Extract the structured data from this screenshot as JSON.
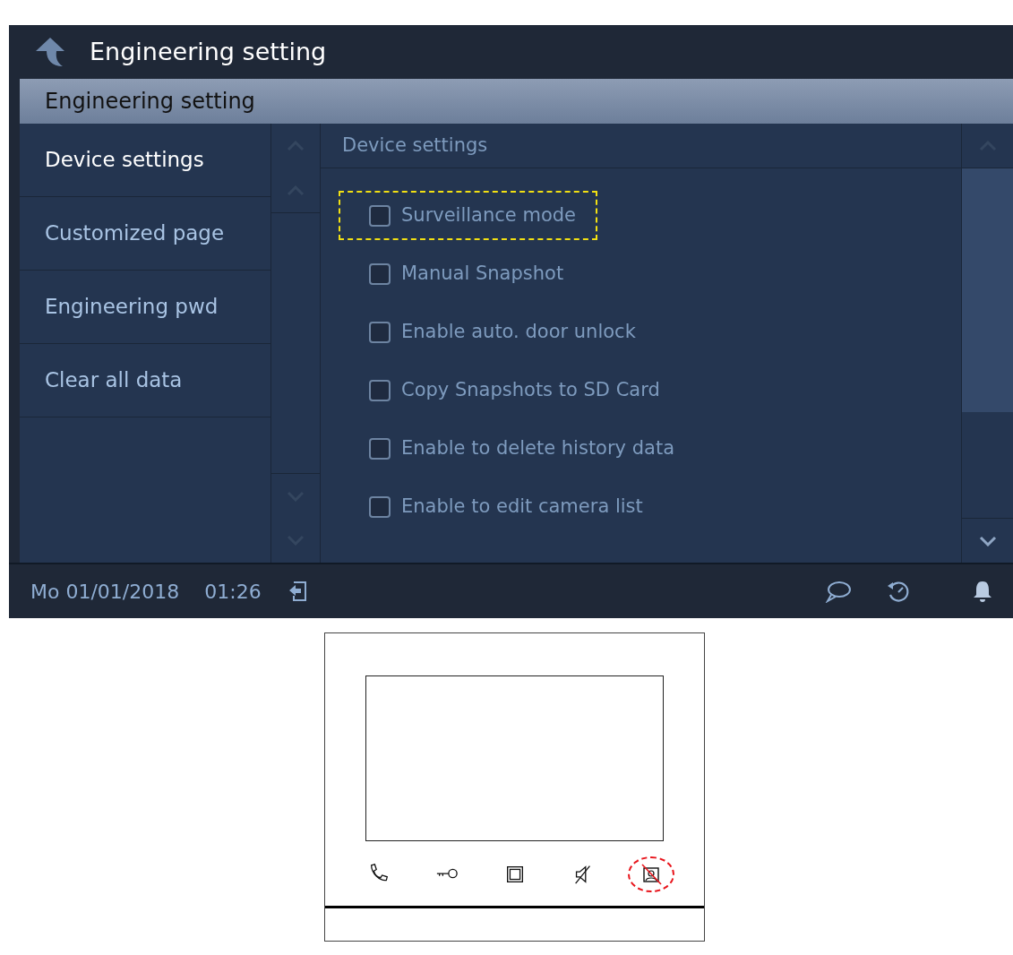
{
  "header": {
    "title": "Engineering setting"
  },
  "subheader": {
    "title": "Engineering setting"
  },
  "sidebar": {
    "items": [
      {
        "label": "Device settings",
        "selected": true
      },
      {
        "label": "Customized page",
        "selected": false
      },
      {
        "label": "Engineering pwd",
        "selected": false
      },
      {
        "label": "Clear all data",
        "selected": false
      }
    ]
  },
  "panel": {
    "heading": "Device settings",
    "options": [
      {
        "label": "Surveillance mode",
        "checked": false,
        "highlighted": true
      },
      {
        "label": "Manual Snapshot",
        "checked": false,
        "highlighted": false
      },
      {
        "label": "Enable auto. door unlock",
        "checked": false,
        "highlighted": false
      },
      {
        "label": "Copy Snapshots to SD Card",
        "checked": false,
        "highlighted": false
      },
      {
        "label": "Enable to delete history data",
        "checked": false,
        "highlighted": false
      },
      {
        "label": "Enable to edit camera list",
        "checked": false,
        "highlighted": false
      }
    ]
  },
  "status_bar": {
    "date": "Mo 01/01/2018",
    "time": "01:26"
  },
  "device": {
    "buttons": [
      {
        "kind": "phone",
        "highlighted": false
      },
      {
        "kind": "key",
        "highlighted": false
      },
      {
        "kind": "square",
        "highlighted": false
      },
      {
        "kind": "mute",
        "highlighted": false
      },
      {
        "kind": "surveillance",
        "highlighted": true
      }
    ]
  }
}
